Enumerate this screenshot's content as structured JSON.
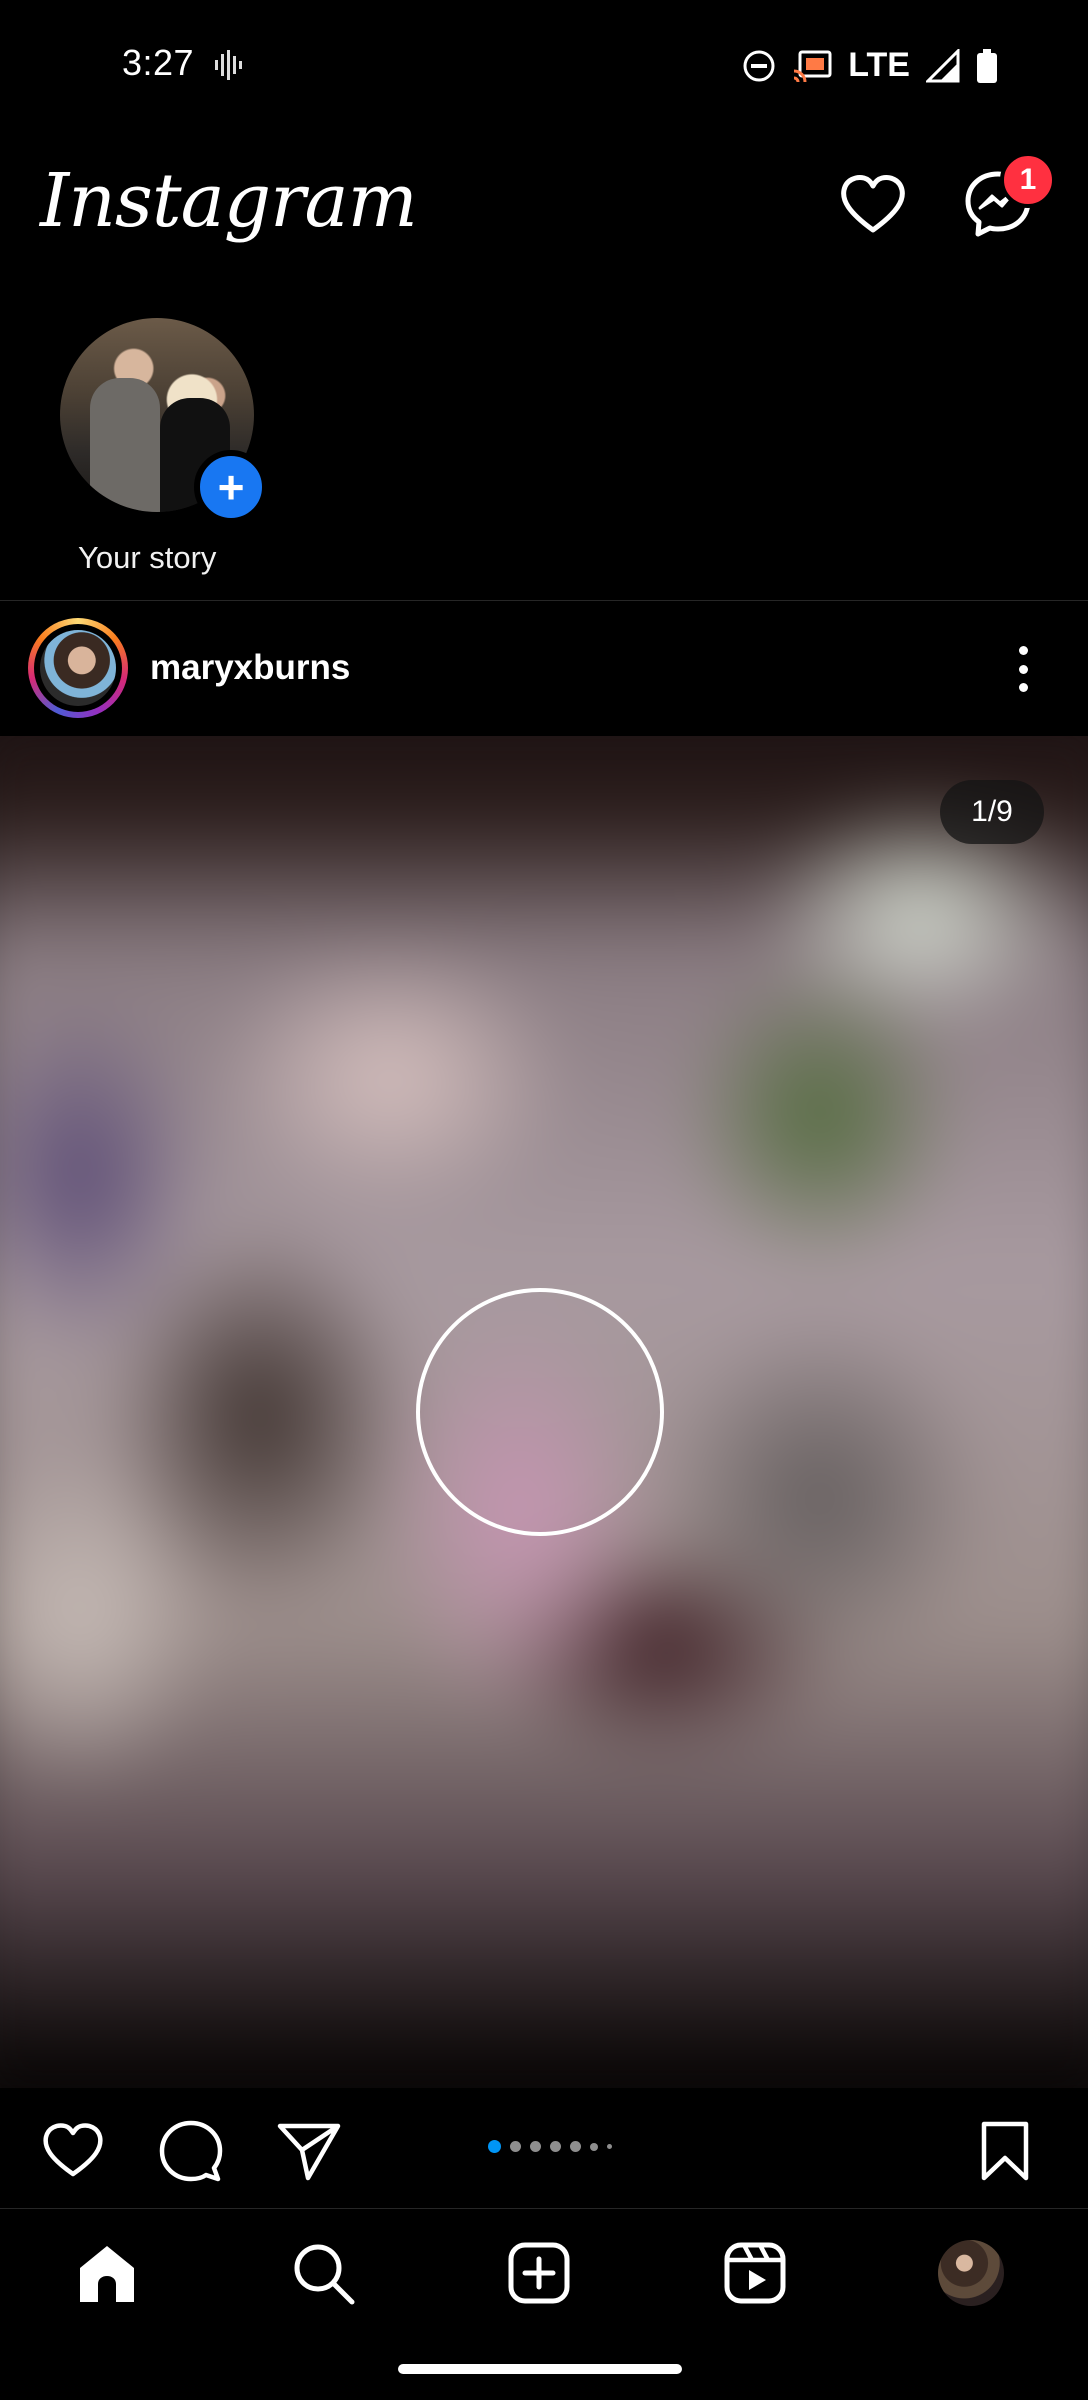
{
  "status_bar": {
    "time": "3:27",
    "network": "LTE"
  },
  "header": {
    "logo": "Instagram",
    "messages_badge": "1"
  },
  "stories": [
    {
      "label": "Your story"
    }
  ],
  "post": {
    "username": "maryxburns",
    "media_counter": "1/9",
    "carousel": {
      "total_dots_visible": 7,
      "active_index": 0
    }
  },
  "colors": {
    "background": "#000000",
    "accent_blue": "#0095f6",
    "badge_red": "#ff3040"
  },
  "icons": {
    "status": [
      "audio-wave-icon",
      "dnd-icon",
      "cast-icon",
      "signal-icon",
      "battery-icon"
    ],
    "header": [
      "heart-icon",
      "messenger-icon"
    ],
    "post_actions": [
      "like-icon",
      "comment-icon",
      "share-icon",
      "bookmark-icon"
    ],
    "bottom_nav": [
      "home-icon",
      "search-icon",
      "create-icon",
      "reels-icon",
      "profile-avatar"
    ]
  }
}
